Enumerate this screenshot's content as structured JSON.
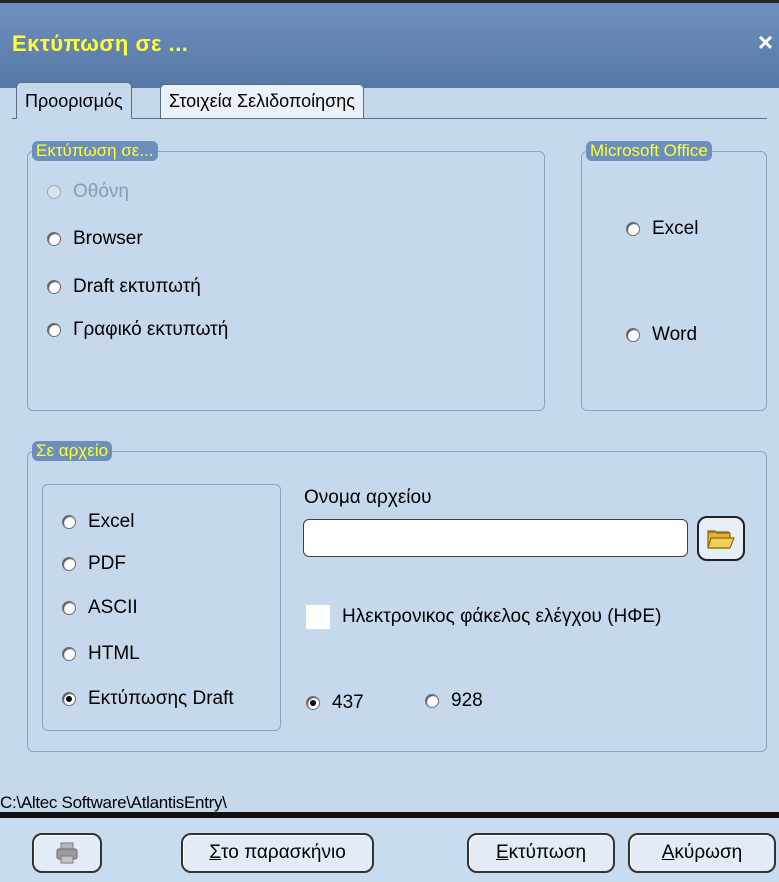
{
  "window": {
    "title": "Εκτύπωση σε ...",
    "close_label": "×"
  },
  "tabs": [
    {
      "label": "Προορισμός",
      "active": true
    },
    {
      "label": "Στοιχεία Σελιδοποίησης",
      "active": false
    }
  ],
  "print_to": {
    "legend": "Εκτύπωση σε...",
    "options": [
      {
        "label": "Οθόνη",
        "disabled": true,
        "selected": false
      },
      {
        "label": "Browser",
        "disabled": false,
        "selected": false
      },
      {
        "label": "Draft εκτυπωτή",
        "disabled": false,
        "selected": false
      },
      {
        "label": "Γραφικό εκτυπωτή",
        "disabled": false,
        "selected": false
      }
    ]
  },
  "office": {
    "legend": "Microsoft Office",
    "options": [
      {
        "label": "Excel",
        "selected": false
      },
      {
        "label": "Word",
        "selected": false
      }
    ]
  },
  "file": {
    "legend": "Σε αρχείο",
    "formats": [
      {
        "label": "Excel",
        "selected": false
      },
      {
        "label": "PDF",
        "selected": false
      },
      {
        "label": "ASCII",
        "selected": false
      },
      {
        "label": "HTML",
        "selected": false
      },
      {
        "label": "Εκτύπωσης Draft",
        "selected": true
      }
    ],
    "filename_label": "Ονομα αρχείου",
    "filename_value": "",
    "efe_checkbox_label": "Ηλεκτρονικος φάκελος ελέγχου (ΗΦΕ)",
    "efe_checked": false,
    "codepages": [
      {
        "label": "437",
        "selected": true
      },
      {
        "label": "928",
        "selected": false
      }
    ]
  },
  "status_path": "C:\\Altec Software\\AtlantisEntry\\",
  "buttons": {
    "background_first": "Σ",
    "background_rest": "το παρασκήνιο",
    "print_first": "Ε",
    "print_rest": "κτύπωση",
    "cancel_first": "Α",
    "cancel_rest": "κύρωση"
  },
  "colors": {
    "title_text": "#ffff33",
    "title_bar": "#5f82b2",
    "background": "#c6d9ec",
    "legend_bg": "#6d8fbe"
  },
  "icons": {
    "close": "close-icon",
    "folder": "folder-open-icon",
    "printer": "printer-icon"
  }
}
